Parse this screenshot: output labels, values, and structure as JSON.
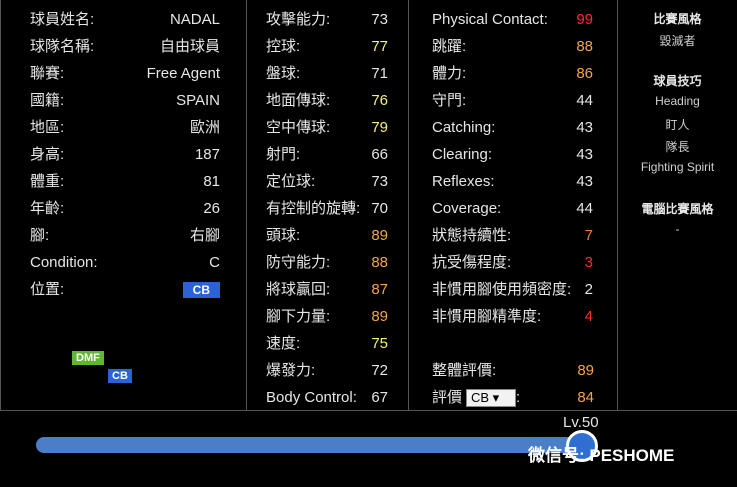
{
  "profile": [
    {
      "label": "球員姓名:",
      "value": "NADAL",
      "color": "white"
    },
    {
      "label": "球隊名稱:",
      "value": "自由球員",
      "color": "white"
    },
    {
      "label": "聯賽:",
      "value": "Free Agent",
      "color": "white"
    },
    {
      "label": "國籍:",
      "value": "SPAIN",
      "color": "white"
    },
    {
      "label": "地區:",
      "value": "歐洲",
      "color": "white"
    },
    {
      "label": "身高:",
      "value": "187",
      "color": "white"
    },
    {
      "label": "體重:",
      "value": "81",
      "color": "white"
    },
    {
      "label": "年齡:",
      "value": "26",
      "color": "white"
    },
    {
      "label": "腳:",
      "value": "右腳",
      "color": "white"
    },
    {
      "label": "Condition:",
      "value": "C",
      "color": "white"
    },
    {
      "label": "位置:",
      "value": "CB",
      "color": "badge"
    }
  ],
  "positions": {
    "dmf": "DMF",
    "cb": "CB"
  },
  "attributes1": [
    {
      "label": "攻擊能力:",
      "value": "73",
      "color": "white"
    },
    {
      "label": "控球:",
      "value": "77",
      "color": "yellow"
    },
    {
      "label": "盤球:",
      "value": "71",
      "color": "white"
    },
    {
      "label": "地面傳球:",
      "value": "76",
      "color": "yellow"
    },
    {
      "label": "空中傳球:",
      "value": "79",
      "color": "yellow"
    },
    {
      "label": "射門:",
      "value": "66",
      "color": "white"
    },
    {
      "label": "定位球:",
      "value": "73",
      "color": "white"
    },
    {
      "label": "有控制的旋轉:",
      "value": "70",
      "color": "white"
    },
    {
      "label": "頭球:",
      "value": "89",
      "color": "orange"
    },
    {
      "label": "防守能力:",
      "value": "88",
      "color": "orange"
    },
    {
      "label": "將球贏回:",
      "value": "87",
      "color": "orange"
    },
    {
      "label": "腳下力量:",
      "value": "89",
      "color": "orange"
    },
    {
      "label": "速度:",
      "value": "75",
      "color": "yellow"
    },
    {
      "label": "爆發力:",
      "value": "72",
      "color": "white"
    },
    {
      "label": "Body Control:",
      "value": "67",
      "color": "white"
    }
  ],
  "attributes2": [
    {
      "label": "Physical Contact:",
      "value": "99",
      "color": "red"
    },
    {
      "label": "跳躍:",
      "value": "88",
      "color": "orange"
    },
    {
      "label": "體力:",
      "value": "86",
      "color": "orange"
    },
    {
      "label": "守門:",
      "value": "44",
      "color": "white"
    },
    {
      "label": "Catching:",
      "value": "43",
      "color": "white"
    },
    {
      "label": "Clearing:",
      "value": "43",
      "color": "white"
    },
    {
      "label": "Reflexes:",
      "value": "43",
      "color": "white"
    },
    {
      "label": "Coverage:",
      "value": "44",
      "color": "white"
    },
    {
      "label": "狀態持續性:",
      "value": "7",
      "color": "dark-orange"
    },
    {
      "label": "抗受傷程度:",
      "value": "3",
      "color": "red"
    },
    {
      "label": "非慣用腳使用頻密度:",
      "value": "2",
      "color": "white"
    },
    {
      "label": "非慣用腳精準度:",
      "value": "4",
      "color": "red"
    }
  ],
  "overall": {
    "label": "整體評價:",
    "value": "89"
  },
  "rating": {
    "label": "評價",
    "select_value": "CB ▾",
    "suffix": ":",
    "value": "84"
  },
  "sidebar": {
    "style_head": "比賽風格",
    "style_value": "毀滅者",
    "skills_head": "球員技巧",
    "skills": [
      "Heading",
      "盯人",
      "隊長",
      "Fighting Spirit"
    ],
    "ai_head": "電腦比賽風格",
    "ai_value": "-"
  },
  "level": {
    "label": "Lv.50",
    "progress": 1.0
  },
  "watermark": "微信号: PESHOME"
}
